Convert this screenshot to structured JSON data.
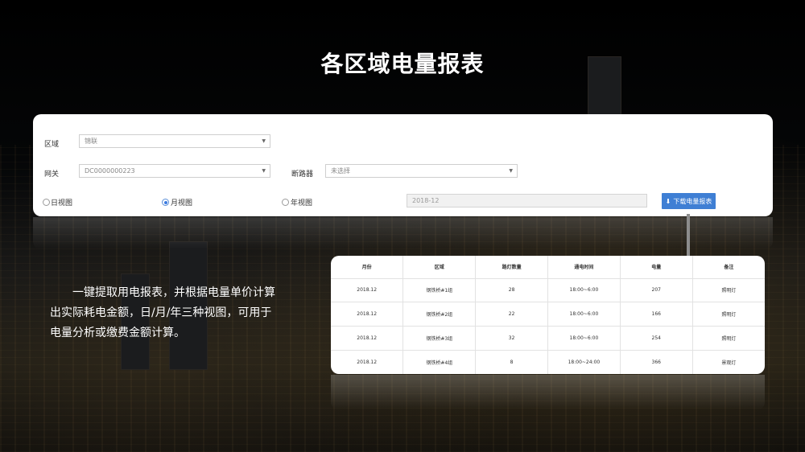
{
  "title": "各区域电量报表",
  "form": {
    "region_label": "区域",
    "region_value": "锦联",
    "gateway_label": "网关",
    "gateway_value": "DC0000000223",
    "breaker_label": "断路器",
    "breaker_value": "未选择",
    "views": [
      {
        "label": "日视图",
        "selected": false
      },
      {
        "label": "月视图",
        "selected": true
      },
      {
        "label": "年视图",
        "selected": false
      }
    ],
    "date_value": "2018-12",
    "download_label": "下载电量报表"
  },
  "description": "一键提取用电报表，并根据电量单价计算出实际耗电金额，日/月/年三种视图，可用于电量分析或缴费金额计算。",
  "table": {
    "headers": [
      "月份",
      "区域",
      "路灯数量",
      "通电时间",
      "电量",
      "备注"
    ],
    "rows": [
      [
        "2018.12",
        "钢铁桥#1组",
        "28",
        "18:00~6:00",
        "207",
        "照明灯"
      ],
      [
        "2018.12",
        "钢铁桥#2组",
        "22",
        "18:00~6:00",
        "166",
        "照明灯"
      ],
      [
        "2018.12",
        "钢铁桥#3组",
        "32",
        "18:00~6:00",
        "254",
        "照明灯"
      ],
      [
        "2018.12",
        "钢铁桥#4组",
        "8",
        "18:00~24:00",
        "366",
        "景观灯"
      ]
    ]
  },
  "colors": {
    "accent": "#3f7fd4",
    "background": "#000000"
  }
}
